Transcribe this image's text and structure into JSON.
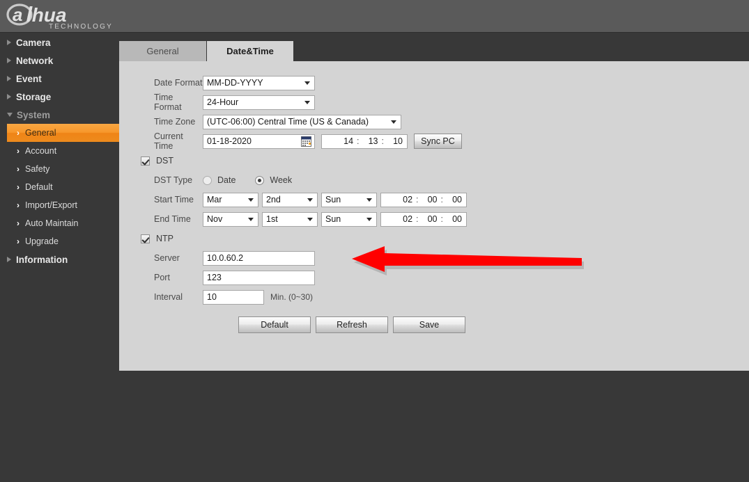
{
  "brand": {
    "name": "alhua",
    "tagline": "TECHNOLOGY",
    "logo_icon": "dahua-logo"
  },
  "sidebar": {
    "top_items": [
      {
        "label": "Camera",
        "expanded": false
      },
      {
        "label": "Network",
        "expanded": false
      },
      {
        "label": "Event",
        "expanded": false
      },
      {
        "label": "Storage",
        "expanded": false
      },
      {
        "label": "System",
        "expanded": true
      },
      {
        "label": "Information",
        "expanded": false
      }
    ],
    "system_children": [
      {
        "label": "General",
        "active": true
      },
      {
        "label": "Account",
        "active": false
      },
      {
        "label": "Safety",
        "active": false
      },
      {
        "label": "Default",
        "active": false
      },
      {
        "label": "Import/Export",
        "active": false
      },
      {
        "label": "Auto Maintain",
        "active": false
      },
      {
        "label": "Upgrade",
        "active": false
      }
    ]
  },
  "tabs": [
    {
      "label": "General",
      "active": false
    },
    {
      "label": "Date&Time",
      "active": true
    }
  ],
  "form": {
    "date_format": {
      "label": "Date Format",
      "value": "MM-DD-YYYY"
    },
    "time_format": {
      "label": "Time Format",
      "value": "24-Hour"
    },
    "time_zone": {
      "label": "Time Zone",
      "value": "(UTC-06:00) Central Time (US & Canada)"
    },
    "current_time": {
      "label": "Current Time",
      "date": "01-18-2020",
      "hour": "14",
      "minute": "13",
      "second": "10",
      "colon": ":",
      "calendar_icon": "calendar-icon",
      "sync_button": "Sync PC"
    },
    "dst": {
      "label": "DST",
      "checked": true
    },
    "dst_type": {
      "label": "DST Type",
      "option_date": "Date",
      "option_week": "Week",
      "selected": "Week"
    },
    "start_time": {
      "label": "Start Time",
      "month": "Mar",
      "week": "2nd",
      "day": "Sun",
      "hour": "02",
      "minute": "00",
      "second": "00",
      "colon": ":"
    },
    "end_time": {
      "label": "End Time",
      "month": "Nov",
      "week": "1st",
      "day": "Sun",
      "hour": "02",
      "minute": "00",
      "second": "00",
      "colon": ":"
    },
    "ntp": {
      "label": "NTP",
      "checked": true
    },
    "server": {
      "label": "Server",
      "value": "10.0.60.2"
    },
    "port": {
      "label": "Port",
      "value": "123"
    },
    "interval": {
      "label": "Interval",
      "value": "10",
      "hint": "Min. (0~30)"
    }
  },
  "buttons": {
    "default": "Default",
    "refresh": "Refresh",
    "save": "Save"
  },
  "annotation": {
    "arrow_icon": "red-arrow-pointing-left",
    "color": "#ff0000",
    "points_at": "Server"
  },
  "colors": {
    "accent_orange": "#f7972b",
    "header_gray": "#5a5a5a",
    "sidebar_dark": "#383838",
    "panel_light": "#d4d4d4",
    "tab_inactive": "#b8b8b8"
  }
}
